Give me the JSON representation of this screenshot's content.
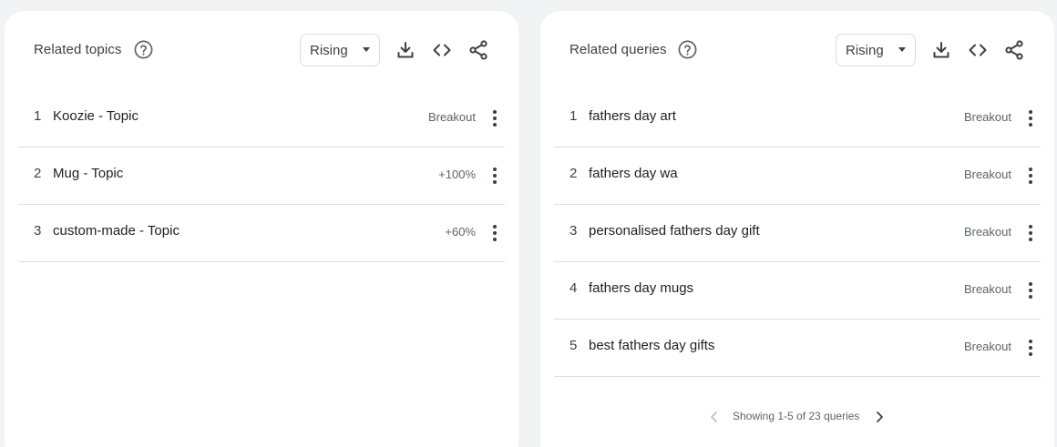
{
  "related_topics": {
    "title": "Related topics",
    "filter": "Rising",
    "rows": [
      {
        "rank": "1",
        "label": "Koozie - Topic",
        "value": "Breakout"
      },
      {
        "rank": "2",
        "label": "Mug - Topic",
        "value": "+100%"
      },
      {
        "rank": "3",
        "label": "custom-made - Topic",
        "value": "+60%"
      }
    ]
  },
  "related_queries": {
    "title": "Related queries",
    "filter": "Rising",
    "rows": [
      {
        "rank": "1",
        "label": "fathers day art",
        "value": "Breakout"
      },
      {
        "rank": "2",
        "label": "fathers day wa",
        "value": "Breakout"
      },
      {
        "rank": "3",
        "label": "personalised fathers day gift",
        "value": "Breakout"
      },
      {
        "rank": "4",
        "label": "fathers day mugs",
        "value": "Breakout"
      },
      {
        "rank": "5",
        "label": "best fathers day gifts",
        "value": "Breakout"
      }
    ],
    "pagination": "Showing 1-5 of 23 queries"
  },
  "icons": {
    "help": "help-circle-icon",
    "download": "download-icon",
    "embed": "code-icon",
    "share": "share-icon",
    "row_menu": "more-vert-icon",
    "prev": "chevron-left-icon",
    "next": "chevron-right-icon"
  },
  "colors": {
    "background": "#f1f3f4",
    "card": "#ffffff",
    "text": "#3c4043",
    "muted": "#5f6368",
    "divider": "#dadce0",
    "disabled": "#bdc1c6"
  }
}
